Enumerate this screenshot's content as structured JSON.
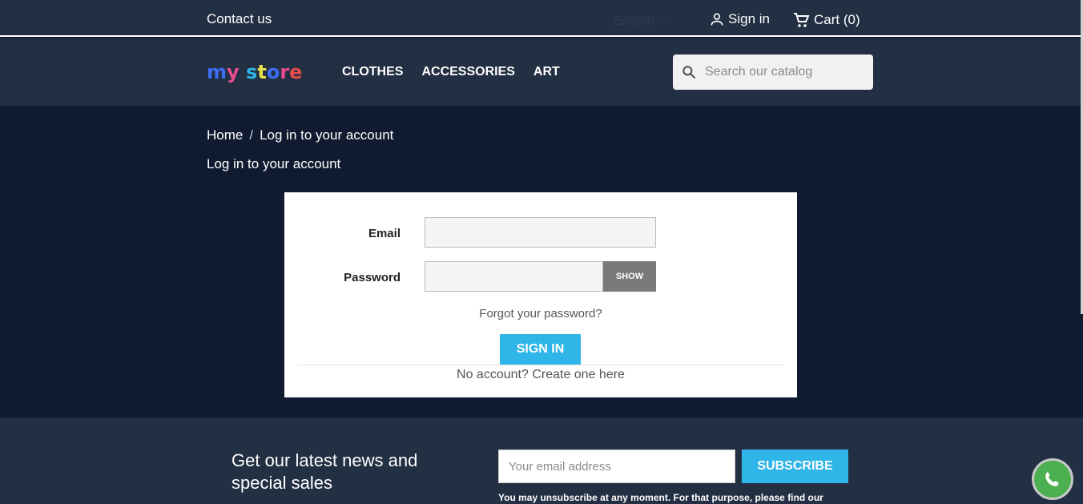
{
  "topbar": {
    "contact": "Contact us",
    "language": "English",
    "sign_in": "Sign in",
    "cart": "Cart (0)"
  },
  "header": {
    "logo_text": "my store",
    "menu": [
      "CLOTHES",
      "ACCESSORIES",
      "ART"
    ],
    "search_placeholder": "Search our catalog"
  },
  "breadcrumb": {
    "home": "Home",
    "separator": "/",
    "current": "Log in to your account"
  },
  "page_title": "Log in to your account",
  "login_form": {
    "email_label": "Email",
    "password_label": "Password",
    "show_label": "SHOW",
    "forgot": "Forgot your password?",
    "sign_in_label": "SIGN IN",
    "no_account": "No account? Create one here"
  },
  "newsletter": {
    "title": "Get our latest news and special sales",
    "email_placeholder": "Your email address",
    "subscribe_label": "SUBSCRIBE",
    "note": "You may unsubscribe at any moment. For that purpose, please find our"
  },
  "colors": {
    "nav_bg": "#232f43",
    "main_bg": "#101a30",
    "accent": "#2fb5e8"
  }
}
